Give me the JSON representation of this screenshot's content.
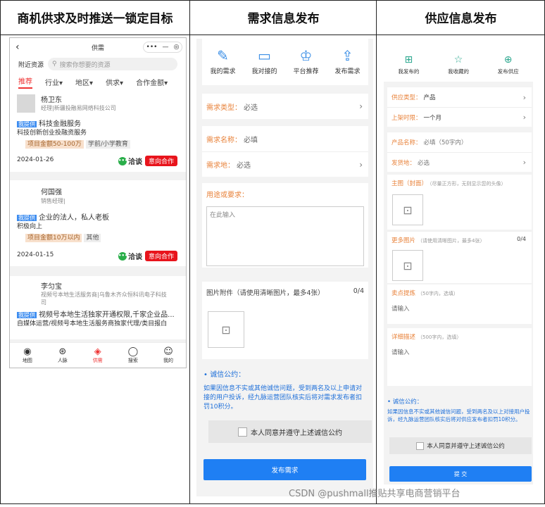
{
  "headers": [
    "商机供求及时推送一锁定目标",
    "需求信息发布",
    "供应信息发布"
  ],
  "panel1": {
    "title": "供需",
    "caps_dots": "•••",
    "caps_min": "—",
    "caps_target": "◎",
    "nearby": "附近资源",
    "search_placeholder": "搜索你想要的资源",
    "tabs": [
      "推荐",
      "行业▾",
      "地区▾",
      "供求▾",
      "合作金额▾"
    ],
    "cards": [
      {
        "name": "杨卫东",
        "sub": "经理|新疆投融易网络科技公司",
        "tag": "我提供",
        "line1": "科技金融服务",
        "line2": "科技创新创业投融资服务",
        "amount": "项目金额50-100万",
        "extra": "学前/小学教育",
        "date": "2024-01-26",
        "chat": "洽谈",
        "coop": "意向合作"
      },
      {
        "name": "何国强",
        "sub": "销售经理|",
        "tag": "我提供",
        "line1": "企业的法人，私人老板",
        "line2": "积极向上",
        "amount": "项目金额10万以内",
        "extra": "其他",
        "date": "2024-01-15",
        "chat": "洽谈",
        "coop": "意向合作"
      },
      {
        "name": "李匀宝",
        "sub": "视频号本地生活服务商|乌鲁木齐众恒科讯电子科技",
        "sub2": "司",
        "tag": "我提供",
        "line1": "视频号本地生活独家开通权限,千家企业品...",
        "line2": "自媒体运营/视频号本地生活服务商独家代理/类目报白"
      }
    ],
    "nav": [
      "地图",
      "人脉",
      "供需",
      "搜索",
      "我的"
    ]
  },
  "panel2": {
    "icons": [
      "我的需求",
      "我对接的",
      "平台推荐",
      "发布需求"
    ],
    "type_k": "需求类型：",
    "type_v": "必选",
    "name_k": "需求名称：",
    "name_v": "必填",
    "loc_k": "需求地：",
    "loc_v": "必选",
    "purpose_k": "用途或要求：",
    "purpose_ph": "在此输入",
    "attach": "图片附件（请使用清晰图片，最多4张）",
    "attach_cnt": "0/4",
    "promise_t": "• 诚信公约：",
    "promise": "如果因信息不实或其他诚信问题，受到两名及以上申请对接的用户投诉，经九脉运营团队核实后将对需求发布者扣罚10积分。",
    "agree": "本人同意并遵守上述诚信公约",
    "submit": "发布需求"
  },
  "panel3": {
    "icons": [
      "我发布的",
      "我收藏的",
      "发布供应"
    ],
    "type_k": "供应类型：",
    "type_v": "产品",
    "time_k": "上架时限：",
    "time_v": "一个月",
    "pname_k": "产品名称：",
    "pname_v": "必填（50字内）",
    "ship_k": "发货地：",
    "ship_v": "必选",
    "cover_k": "主图（封面）",
    "cover_h": "（尽量正方形，无则显示您的头像）",
    "more_k": "更多图片",
    "more_h": "（请使用清晰图片，最多4张）",
    "more_cnt": "0/4",
    "sell_k": "卖点提炼",
    "sell_h": "（50字内，选填）",
    "sell_ph": "请输入",
    "desc_k": "详细描述",
    "desc_h": "（500字内，选填）",
    "desc_ph": "请输入",
    "promise_t": "• 诚信公约：",
    "promise": "如果因信息不实或其他诚信问题，受到两名及以上对接用户投诉，经九脉运营团队核实后将对供应发布者扣罚10积分。",
    "agree": "本人同意并遵守上述诚信公约",
    "submit": "提 交"
  },
  "watermark": "CSDN @pushmall推贴共享电商营销平台",
  "colors": {
    "accent_blue": "#1f7ff3",
    "accent_red": "#e8141c",
    "label_orange": "#e8823a"
  }
}
